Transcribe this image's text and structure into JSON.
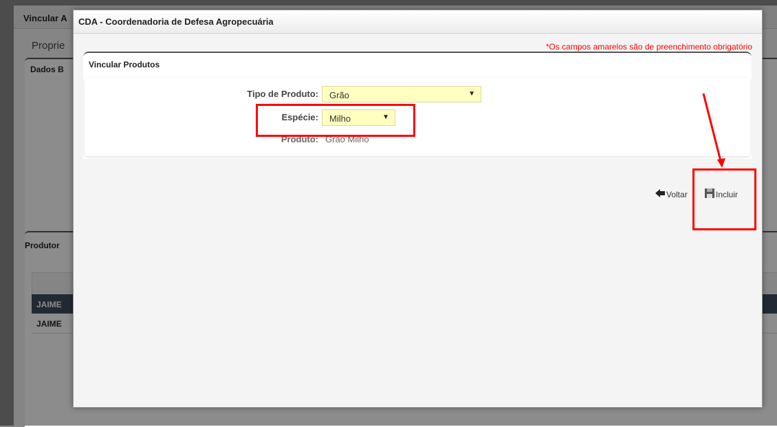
{
  "background": {
    "window_title": "Vincular A",
    "tab_label": "Proprie",
    "section1_title": "Dados B",
    "section2_title": "Produtor",
    "rows": [
      "JAIME",
      "JAIME"
    ]
  },
  "modal": {
    "title": "CDA - Coordenadoria de Defesa Agropecuária",
    "required_note": "*Os campos amarelos são de preenchimento obrigatório",
    "panel_title": "Vincular Produtos",
    "fields": {
      "tipo_label": "Tipo de Produto:",
      "tipo_value": "Grão",
      "especie_label": "Espécie:",
      "especie_value": "Milho",
      "produto_label": "Produto:",
      "produto_value": "Grão Milho"
    },
    "buttons": {
      "voltar": "Voltar",
      "incluir": "Incluir"
    }
  },
  "colors": {
    "required_yellow": "#ffffc0",
    "annotation_red": "#ff0000",
    "table_dark_row": "#3c4e60"
  },
  "icons": {
    "voltar": "arrow-left-icon",
    "incluir": "save-disk-icon",
    "dropdown": "triangle-down-icon"
  }
}
